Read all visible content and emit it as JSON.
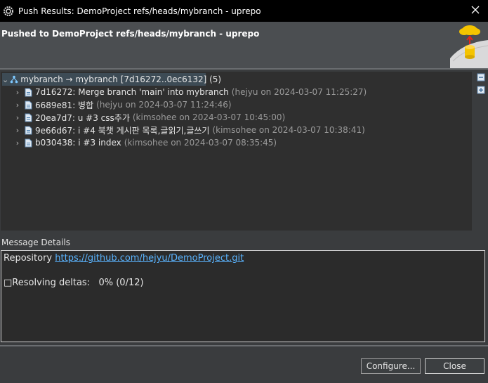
{
  "window": {
    "title": "Push Results: DemoProject refs/heads/mybranch - uprepo",
    "app_icon": "gear-icon",
    "close_icon": "close-icon"
  },
  "header": {
    "title": "Pushed to DemoProject refs/heads/mybranch - uprepo",
    "banner_icon": "cloud-push-icon"
  },
  "tree": {
    "root": {
      "label": "mybranch → mybranch [7d16272..0ec6132] (5)",
      "icon": "branch-icon"
    },
    "commits": [
      {
        "message": "7d16272: Merge branch 'main' into mybranch",
        "meta": "(hejyu on 2024-03-07 11:25:27)"
      },
      {
        "message": "6689e81: 병합",
        "meta": "(hejyu on 2024-03-07 11:24:46)"
      },
      {
        "message": "20ea7d7: u #3 css추가",
        "meta": "(kimsohee on 2024-03-07 10:45:00)"
      },
      {
        "message": "9e66d67: i #4 북챗 게시판 목록,글읽기,글쓰기",
        "meta": "(kimsohee on 2024-03-07 10:38:41)"
      },
      {
        "message": "b030438: i #3 index",
        "meta": "(kimsohee on 2024-03-07 08:35:45)"
      }
    ]
  },
  "message_details": {
    "label": "Message Details",
    "repo_prefix": "Repository",
    "repo_url": "https://github.com/hejyu/DemoProject.git",
    "progress": "□Resolving deltas:   0% (0/12)"
  },
  "buttons": {
    "configure": "Configure...",
    "close": "Close"
  }
}
